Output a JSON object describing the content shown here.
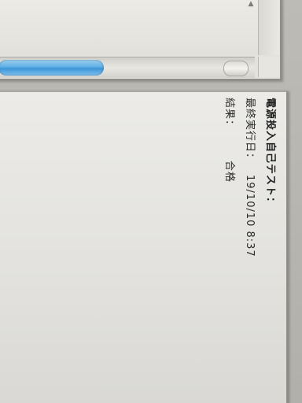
{
  "top_panel": {
    "scroll_arrow": "▲"
  },
  "section": {
    "title": "電源投入自己テスト："
  },
  "rows": {
    "last_run": {
      "label": "最終実行日：",
      "value": "19/10/10 8:37"
    },
    "result": {
      "label": "結果：",
      "value": "合格"
    }
  },
  "colors": {
    "scroll_thumb": "#5fb0e6",
    "pane_background": "#ecebe7",
    "text": "#2a2a2a"
  }
}
